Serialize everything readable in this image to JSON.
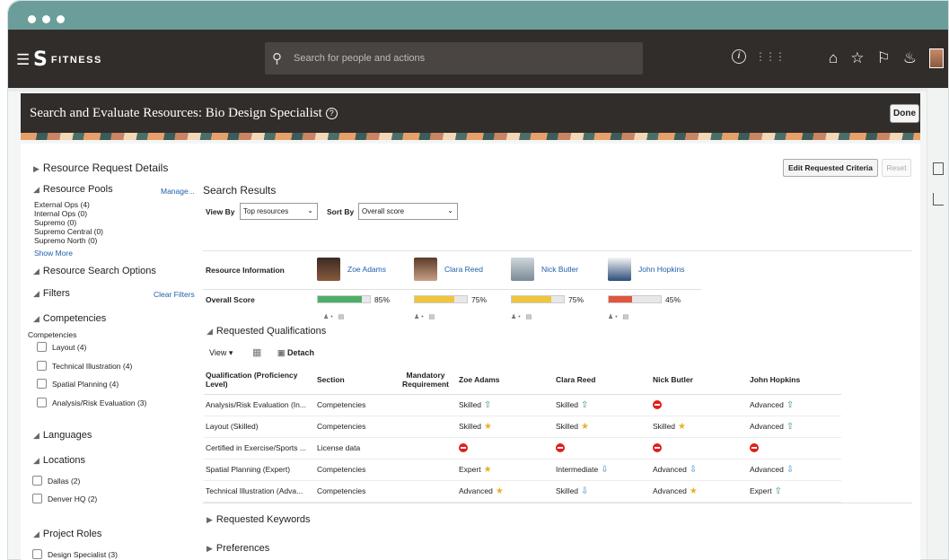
{
  "app": {
    "name": "FITNESS"
  },
  "search": {
    "placeholder": "Search for people and actions"
  },
  "page": {
    "title": "Search and Evaluate Resources: Bio Design Specialist",
    "done_label": "Done"
  },
  "left": {
    "resource_request_details": "Resource Request Details",
    "resource_pools": "Resource Pools",
    "manage_link": "Manage...",
    "pools": [
      "External Ops (4)",
      "Internal Ops (0)",
      "Supremo (0)",
      "Supremo Central (0)",
      "Supremo North (0)"
    ],
    "show_more": "Show More",
    "resource_search_options": "Resource Search Options",
    "filters": "Filters",
    "clear_filters": "Clear Filters",
    "competencies": "Competencies",
    "competencies_sub": "Competencies",
    "competency_items": [
      "Layout (4)",
      "Technical Illustration (4)",
      "Spatial Planning (4)",
      "Analysis/Risk Evaluation (3)"
    ],
    "languages": "Languages",
    "locations": "Locations",
    "location_items": [
      "Dallas (2)",
      "Denver HQ (2)"
    ],
    "project_roles": "Project Roles",
    "project_role_items": [
      "Design Specialist (3)"
    ]
  },
  "results": {
    "title": "Search Results",
    "edit_criteria": "Edit Requested Criteria",
    "reset": "Reset",
    "view_by_label": "View By",
    "view_by_value": "Top resources",
    "sort_by_label": "Sort By",
    "sort_by_value": "Overall score",
    "resource_info_label": "Resource Information",
    "overall_score_label": "Overall Score",
    "people": [
      {
        "name": "Zoe Adams",
        "score_text": "85%",
        "score": 85,
        "color": "#4caf6a"
      },
      {
        "name": "Clara Reed",
        "score_text": "75%",
        "score": 75,
        "color": "#f0c53c"
      },
      {
        "name": "Nick Butler",
        "score_text": "75%",
        "score": 75,
        "color": "#f0c53c"
      },
      {
        "name": "John Hopkins",
        "score_text": "45%",
        "score": 45,
        "color": "#e2553e"
      }
    ]
  },
  "qualifications": {
    "title": "Requested Qualifications",
    "view_menu": "View",
    "detach": "Detach",
    "headers": [
      "Qualification (Proficiency Level)",
      "Section",
      "Mandatory Requirement",
      "Zoe Adams",
      "Clara Reed",
      "Nick Butler",
      "John Hopkins"
    ],
    "rows": [
      {
        "qual": "Analysis/Risk Evaluation (In...",
        "section": "Competencies",
        "cells": [
          [
            "Skilled",
            "up"
          ],
          [
            "Skilled",
            "up"
          ],
          [
            "",
            "no"
          ],
          [
            "Advanced",
            "up"
          ]
        ]
      },
      {
        "qual": "Layout (Skilled)",
        "section": "Competencies",
        "cells": [
          [
            "Skilled",
            "star"
          ],
          [
            "Skilled",
            "star"
          ],
          [
            "Skilled",
            "star"
          ],
          [
            "Advanced",
            "up"
          ]
        ]
      },
      {
        "qual": "Certified in Exercise/Sports ...",
        "section": "License data",
        "cells": [
          [
            "",
            "no"
          ],
          [
            "",
            "no"
          ],
          [
            "",
            "no"
          ],
          [
            "",
            "no"
          ]
        ]
      },
      {
        "qual": "Spatial Planning (Expert)",
        "section": "Competencies",
        "cells": [
          [
            "Expert",
            "star"
          ],
          [
            "Intermediate",
            "down"
          ],
          [
            "Advanced",
            "down"
          ],
          [
            "Advanced",
            "down"
          ]
        ]
      },
      {
        "qual": "Technical Illustration (Adva...",
        "section": "Competencies",
        "cells": [
          [
            "Advanced",
            "star"
          ],
          [
            "Skilled",
            "down"
          ],
          [
            "Advanced",
            "star"
          ],
          [
            "Expert",
            "up"
          ]
        ]
      }
    ]
  },
  "requested_keywords": "Requested Keywords",
  "preferences": "Preferences"
}
